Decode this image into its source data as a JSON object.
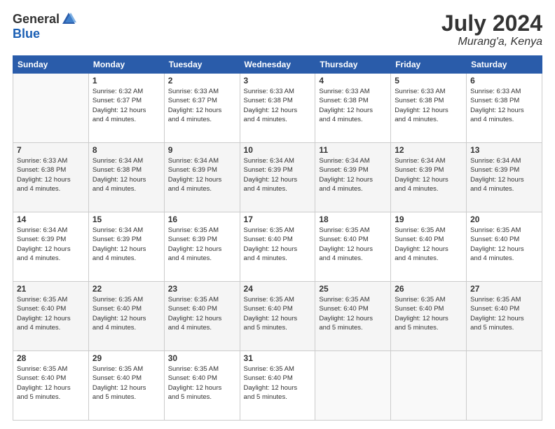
{
  "header": {
    "logo_general": "General",
    "logo_blue": "Blue",
    "month_title": "July 2024",
    "location": "Murang'a, Kenya"
  },
  "calendar": {
    "days_of_week": [
      "Sunday",
      "Monday",
      "Tuesday",
      "Wednesday",
      "Thursday",
      "Friday",
      "Saturday"
    ],
    "weeks": [
      [
        {
          "day": "",
          "info": ""
        },
        {
          "day": "1",
          "info": "Sunrise: 6:32 AM\nSunset: 6:37 PM\nDaylight: 12 hours\nand 4 minutes."
        },
        {
          "day": "2",
          "info": "Sunrise: 6:33 AM\nSunset: 6:37 PM\nDaylight: 12 hours\nand 4 minutes."
        },
        {
          "day": "3",
          "info": "Sunrise: 6:33 AM\nSunset: 6:38 PM\nDaylight: 12 hours\nand 4 minutes."
        },
        {
          "day": "4",
          "info": "Sunrise: 6:33 AM\nSunset: 6:38 PM\nDaylight: 12 hours\nand 4 minutes."
        },
        {
          "day": "5",
          "info": "Sunrise: 6:33 AM\nSunset: 6:38 PM\nDaylight: 12 hours\nand 4 minutes."
        },
        {
          "day": "6",
          "info": "Sunrise: 6:33 AM\nSunset: 6:38 PM\nDaylight: 12 hours\nand 4 minutes."
        }
      ],
      [
        {
          "day": "7",
          "info": "Sunrise: 6:33 AM\nSunset: 6:38 PM\nDaylight: 12 hours\nand 4 minutes."
        },
        {
          "day": "8",
          "info": "Sunrise: 6:34 AM\nSunset: 6:38 PM\nDaylight: 12 hours\nand 4 minutes."
        },
        {
          "day": "9",
          "info": "Sunrise: 6:34 AM\nSunset: 6:39 PM\nDaylight: 12 hours\nand 4 minutes."
        },
        {
          "day": "10",
          "info": "Sunrise: 6:34 AM\nSunset: 6:39 PM\nDaylight: 12 hours\nand 4 minutes."
        },
        {
          "day": "11",
          "info": "Sunrise: 6:34 AM\nSunset: 6:39 PM\nDaylight: 12 hours\nand 4 minutes."
        },
        {
          "day": "12",
          "info": "Sunrise: 6:34 AM\nSunset: 6:39 PM\nDaylight: 12 hours\nand 4 minutes."
        },
        {
          "day": "13",
          "info": "Sunrise: 6:34 AM\nSunset: 6:39 PM\nDaylight: 12 hours\nand 4 minutes."
        }
      ],
      [
        {
          "day": "14",
          "info": "Sunrise: 6:34 AM\nSunset: 6:39 PM\nDaylight: 12 hours\nand 4 minutes."
        },
        {
          "day": "15",
          "info": "Sunrise: 6:34 AM\nSunset: 6:39 PM\nDaylight: 12 hours\nand 4 minutes."
        },
        {
          "day": "16",
          "info": "Sunrise: 6:35 AM\nSunset: 6:39 PM\nDaylight: 12 hours\nand 4 minutes."
        },
        {
          "day": "17",
          "info": "Sunrise: 6:35 AM\nSunset: 6:40 PM\nDaylight: 12 hours\nand 4 minutes."
        },
        {
          "day": "18",
          "info": "Sunrise: 6:35 AM\nSunset: 6:40 PM\nDaylight: 12 hours\nand 4 minutes."
        },
        {
          "day": "19",
          "info": "Sunrise: 6:35 AM\nSunset: 6:40 PM\nDaylight: 12 hours\nand 4 minutes."
        },
        {
          "day": "20",
          "info": "Sunrise: 6:35 AM\nSunset: 6:40 PM\nDaylight: 12 hours\nand 4 minutes."
        }
      ],
      [
        {
          "day": "21",
          "info": "Sunrise: 6:35 AM\nSunset: 6:40 PM\nDaylight: 12 hours\nand 4 minutes."
        },
        {
          "day": "22",
          "info": "Sunrise: 6:35 AM\nSunset: 6:40 PM\nDaylight: 12 hours\nand 4 minutes."
        },
        {
          "day": "23",
          "info": "Sunrise: 6:35 AM\nSunset: 6:40 PM\nDaylight: 12 hours\nand 4 minutes."
        },
        {
          "day": "24",
          "info": "Sunrise: 6:35 AM\nSunset: 6:40 PM\nDaylight: 12 hours\nand 5 minutes."
        },
        {
          "day": "25",
          "info": "Sunrise: 6:35 AM\nSunset: 6:40 PM\nDaylight: 12 hours\nand 5 minutes."
        },
        {
          "day": "26",
          "info": "Sunrise: 6:35 AM\nSunset: 6:40 PM\nDaylight: 12 hours\nand 5 minutes."
        },
        {
          "day": "27",
          "info": "Sunrise: 6:35 AM\nSunset: 6:40 PM\nDaylight: 12 hours\nand 5 minutes."
        }
      ],
      [
        {
          "day": "28",
          "info": "Sunrise: 6:35 AM\nSunset: 6:40 PM\nDaylight: 12 hours\nand 5 minutes."
        },
        {
          "day": "29",
          "info": "Sunrise: 6:35 AM\nSunset: 6:40 PM\nDaylight: 12 hours\nand 5 minutes."
        },
        {
          "day": "30",
          "info": "Sunrise: 6:35 AM\nSunset: 6:40 PM\nDaylight: 12 hours\nand 5 minutes."
        },
        {
          "day": "31",
          "info": "Sunrise: 6:35 AM\nSunset: 6:40 PM\nDaylight: 12 hours\nand 5 minutes."
        },
        {
          "day": "",
          "info": ""
        },
        {
          "day": "",
          "info": ""
        },
        {
          "day": "",
          "info": ""
        }
      ]
    ]
  }
}
